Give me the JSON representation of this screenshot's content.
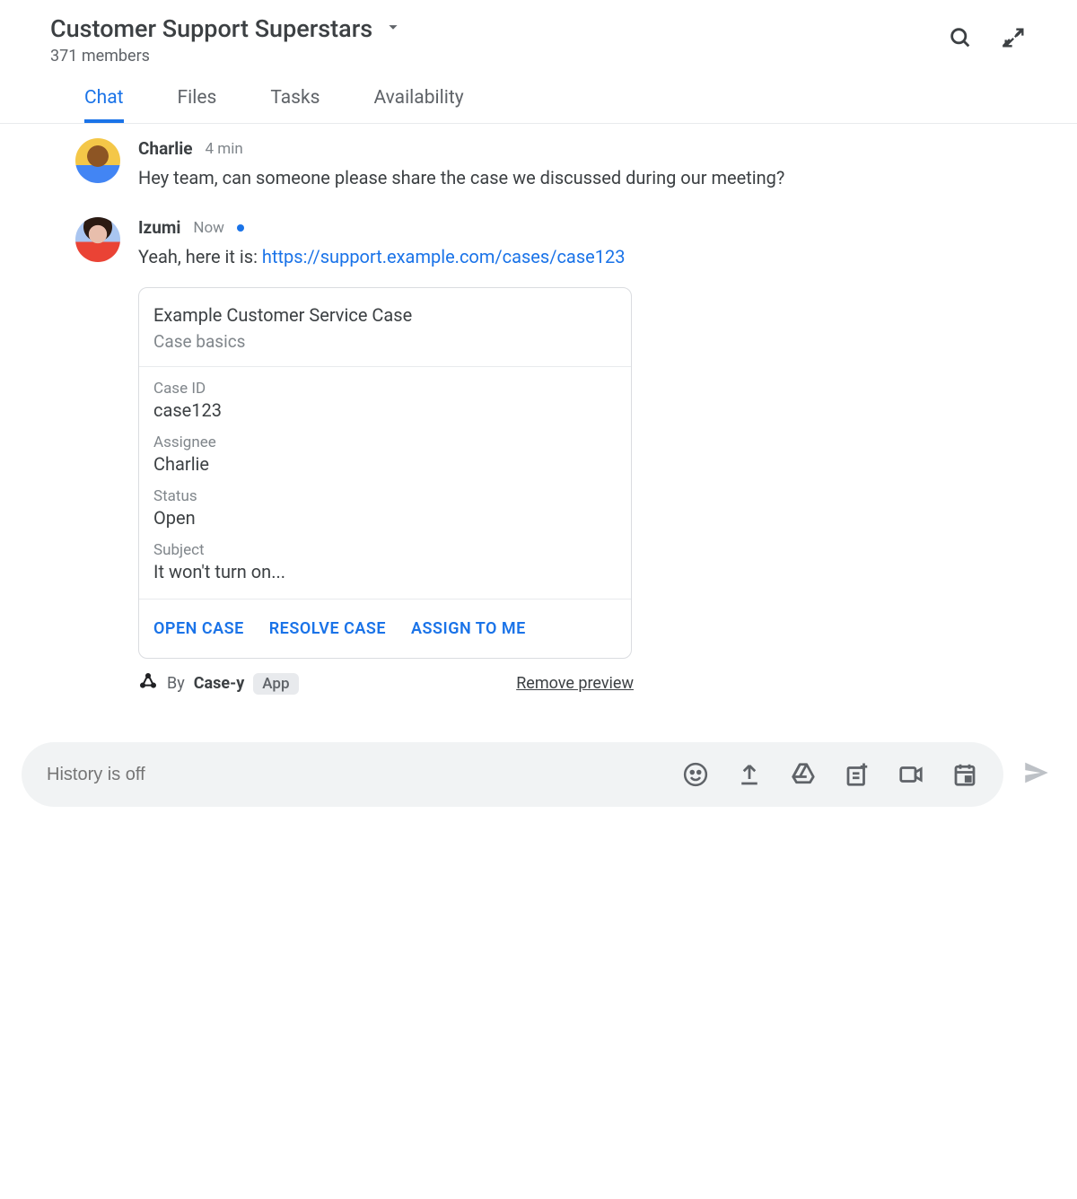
{
  "header": {
    "title": "Customer Support Superstars",
    "members": "371 members"
  },
  "tabs": [
    {
      "label": "Chat",
      "active": true
    },
    {
      "label": "Files",
      "active": false
    },
    {
      "label": "Tasks",
      "active": false
    },
    {
      "label": "Availability",
      "active": false
    }
  ],
  "messages": {
    "m0": {
      "author": "Charlie",
      "time": "4 min",
      "text": "Hey team, can someone please share the case we discussed during our meeting?"
    },
    "m1": {
      "author": "Izumi",
      "time": "Now",
      "text_prefix": "Yeah, here it is: ",
      "link": "https://support.example.com/cases/case123"
    }
  },
  "card": {
    "title": "Example Customer Service Case",
    "subtitle": "Case basics",
    "fields": {
      "case_id": {
        "label": "Case ID",
        "value": "case123"
      },
      "assignee": {
        "label": "Assignee",
        "value": "Charlie"
      },
      "status": {
        "label": "Status",
        "value": "Open"
      },
      "subject": {
        "label": "Subject",
        "value": "It won't turn on..."
      }
    },
    "actions": {
      "open": "OPEN CASE",
      "resolve": "RESOLVE CASE",
      "assign": "ASSIGN TO ME"
    },
    "footer": {
      "by": "By",
      "app_name": "Case-y",
      "badge": "App",
      "remove": "Remove preview"
    }
  },
  "composer": {
    "placeholder": "History is off"
  }
}
